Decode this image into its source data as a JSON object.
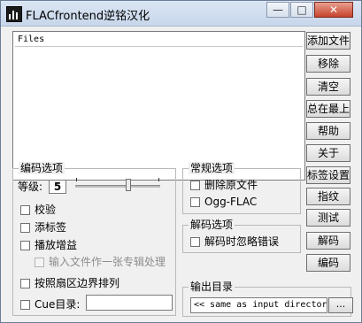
{
  "window": {
    "title": "FLACfrontend逆铭汉化",
    "minimize_glyph": "—",
    "maximize_glyph": "□",
    "close_glyph": "✕"
  },
  "files": {
    "column_header": "Files"
  },
  "buttons": [
    "添加文件",
    "移除",
    "清空",
    "总在最上",
    "帮助",
    "关于",
    "标签设置",
    "指纹",
    "测试",
    "解码",
    "编码"
  ],
  "encode_options": {
    "title": "编码选项",
    "level_label": "等级:",
    "level_value": "5",
    "level_max": 8,
    "verify": {
      "label": "校验",
      "checked": false
    },
    "tag": {
      "label": "添标签",
      "checked": false
    },
    "replay_gain": {
      "label": "播放增益",
      "checked": false
    },
    "album_mode": {
      "label": "输入文件作一张专辑处理",
      "checked": false,
      "enabled": false
    },
    "sector_align": {
      "label": "按照扇区边界排列",
      "checked": false
    },
    "cue": {
      "label": "Cue目录:",
      "checked": false,
      "value": ""
    }
  },
  "general_options": {
    "title": "常规选项",
    "delete_source": {
      "label": "删除原文件",
      "checked": false
    },
    "ogg_flac": {
      "label": "Ogg-FLAC",
      "checked": false
    }
  },
  "decode_options": {
    "title": "解码选项",
    "ignore_errors": {
      "label": "解码时忽略错误",
      "checked": false
    }
  },
  "output_dir": {
    "title": "输出目录",
    "value": "<< same as input directory >>",
    "browse_label": "..."
  }
}
